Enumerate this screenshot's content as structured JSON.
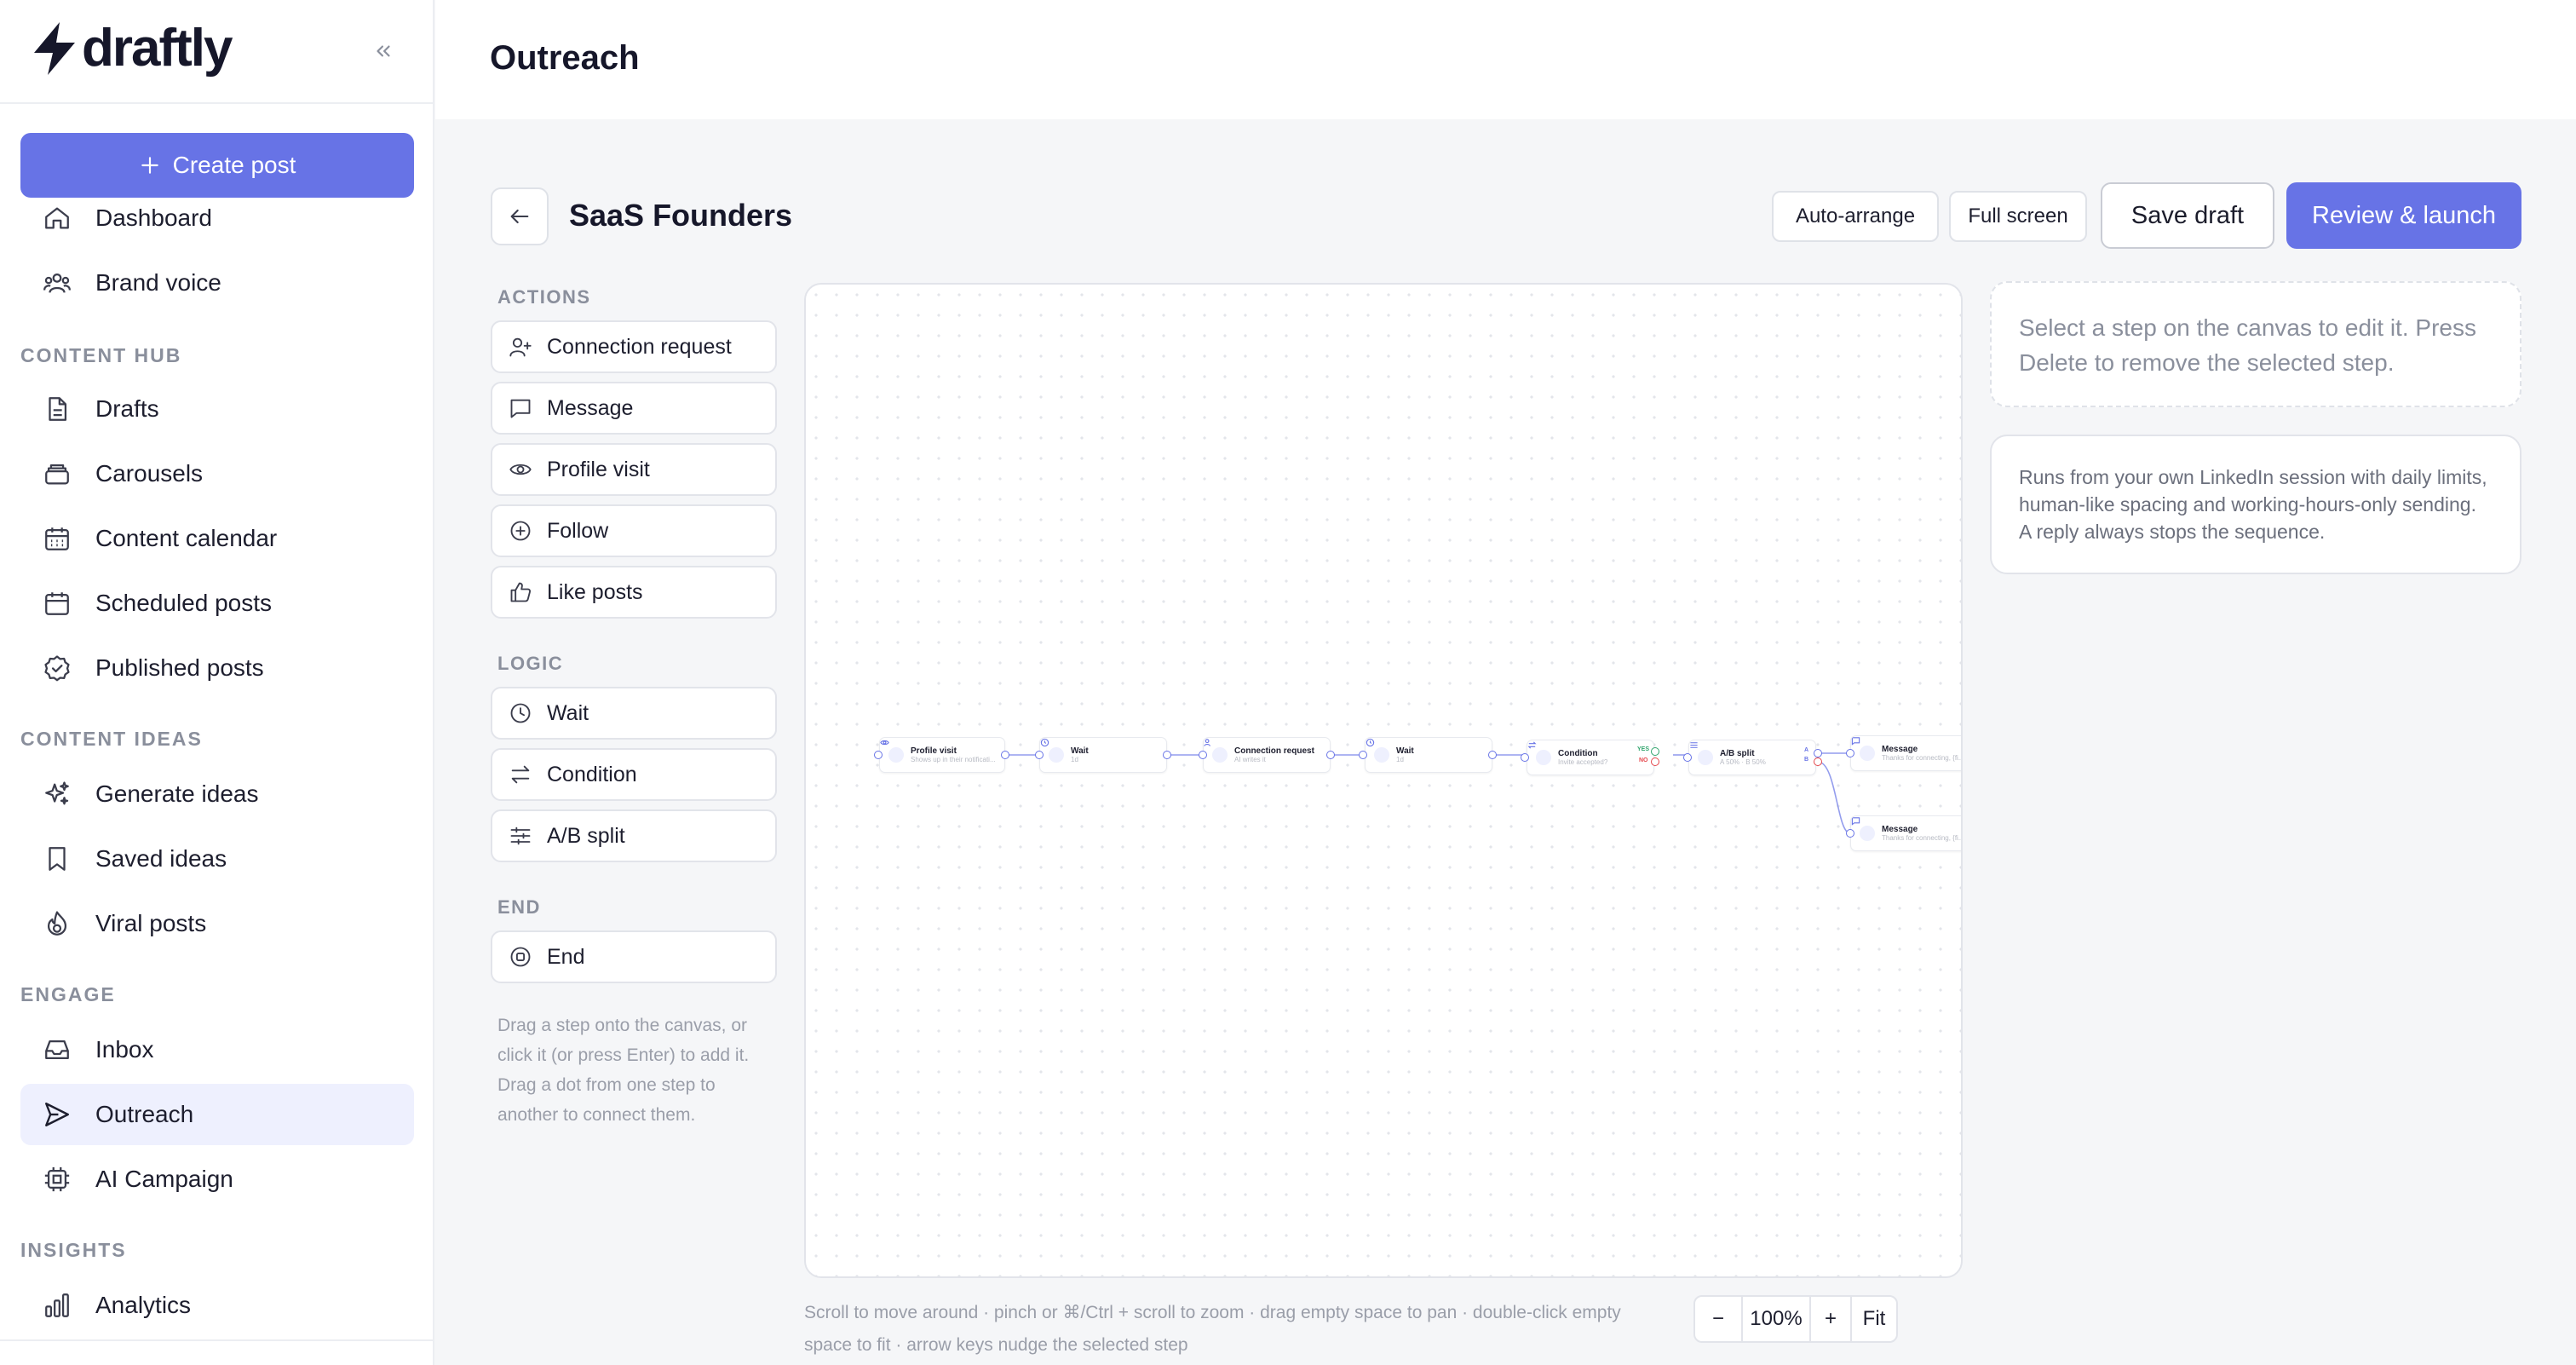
{
  "app": {
    "logo_text": "draftly",
    "create_label": "Create post"
  },
  "sidebar": {
    "items": [
      {
        "label": "Dashboard",
        "icon": "home-icon"
      },
      {
        "label": "Brand voice",
        "icon": "users-icon"
      }
    ],
    "sections": [
      {
        "title": "CONTENT HUB",
        "items": [
          {
            "label": "Drafts",
            "icon": "file-icon"
          },
          {
            "label": "Carousels",
            "icon": "layers-icon"
          },
          {
            "label": "Content calendar",
            "icon": "calendar-grid-icon"
          },
          {
            "label": "Scheduled posts",
            "icon": "calendar-icon"
          },
          {
            "label": "Published posts",
            "icon": "check-circle-icon"
          }
        ]
      },
      {
        "title": "CONTENT IDEAS",
        "items": [
          {
            "label": "Generate ideas",
            "icon": "sparkles-icon"
          },
          {
            "label": "Saved ideas",
            "icon": "bookmark-icon"
          },
          {
            "label": "Viral posts",
            "icon": "flame-icon"
          }
        ]
      },
      {
        "title": "ENGAGE",
        "items": [
          {
            "label": "Inbox",
            "icon": "inbox-icon"
          },
          {
            "label": "Outreach",
            "icon": "send-icon",
            "active": true
          },
          {
            "label": "AI Campaign",
            "icon": "cpu-icon"
          }
        ]
      },
      {
        "title": "INSIGHTS",
        "items": [
          {
            "label": "Analytics",
            "icon": "bar-chart-icon"
          }
        ]
      }
    ]
  },
  "header": {
    "title": "Outreach"
  },
  "toolbar": {
    "sequence_title": "SaaS Founders",
    "auto_arrange": "Auto-arrange",
    "full_screen": "Full screen",
    "save_draft": "Save draft",
    "review_launch": "Review & launch"
  },
  "palette": {
    "actions_title": "ACTIONS",
    "actions": [
      {
        "label": "Connection request",
        "icon": "user-plus-icon"
      },
      {
        "label": "Message",
        "icon": "message-icon"
      },
      {
        "label": "Profile visit",
        "icon": "eye-icon"
      },
      {
        "label": "Follow",
        "icon": "plus-circle-icon"
      },
      {
        "label": "Like posts",
        "icon": "thumbs-up-icon"
      }
    ],
    "logic_title": "LOGIC",
    "logic": [
      {
        "label": "Wait",
        "icon": "clock-icon"
      },
      {
        "label": "Condition",
        "icon": "swap-icon"
      },
      {
        "label": "A/B split",
        "icon": "sliders-icon"
      }
    ],
    "end_title": "END",
    "end": [
      {
        "label": "End",
        "icon": "stop-circle-icon"
      }
    ],
    "help": "Drag a step onto the canvas, or click it (or press Enter) to add it. Drag a dot from one step to another to connect them."
  },
  "canvas": {
    "nodes": [
      {
        "title": "Profile visit",
        "sub": "Shows up in their notificati..."
      },
      {
        "title": "Wait",
        "sub": "1d"
      },
      {
        "title": "Connection request",
        "sub": "AI writes it"
      },
      {
        "title": "Wait",
        "sub": "1d"
      },
      {
        "title": "Condition",
        "sub": "Invite accepted?"
      },
      {
        "title": "A/B split",
        "sub": "A 50% · B 50%"
      },
      {
        "title": "Message",
        "sub": "Thanks for connecting, {fi..."
      },
      {
        "title": "Message",
        "sub": "Thanks for connecting, {fi..."
      }
    ],
    "yes_label": "YES",
    "no_label": "NO",
    "a_label": "A",
    "b_label": "B",
    "help": "Scroll to move around · pinch or ⌘/Ctrl + scroll to zoom · drag empty space to pan · double-click empty space to fit · arrow keys nudge the selected step"
  },
  "zoom": {
    "minus": "−",
    "value": "100%",
    "plus": "+",
    "fit": "Fit"
  },
  "panels": {
    "hint": "Select a step on the canvas to edit it. Press Delete to remove the selected step.",
    "info": "Runs from your own LinkedIn session with daily limits, human-like spacing and working-hours-only sending. A reply always stops the sequence."
  },
  "colors": {
    "accent": "#6773e6",
    "accent_soft": "#eef0fe",
    "yes": "#30a46c",
    "no": "#e5484d"
  }
}
